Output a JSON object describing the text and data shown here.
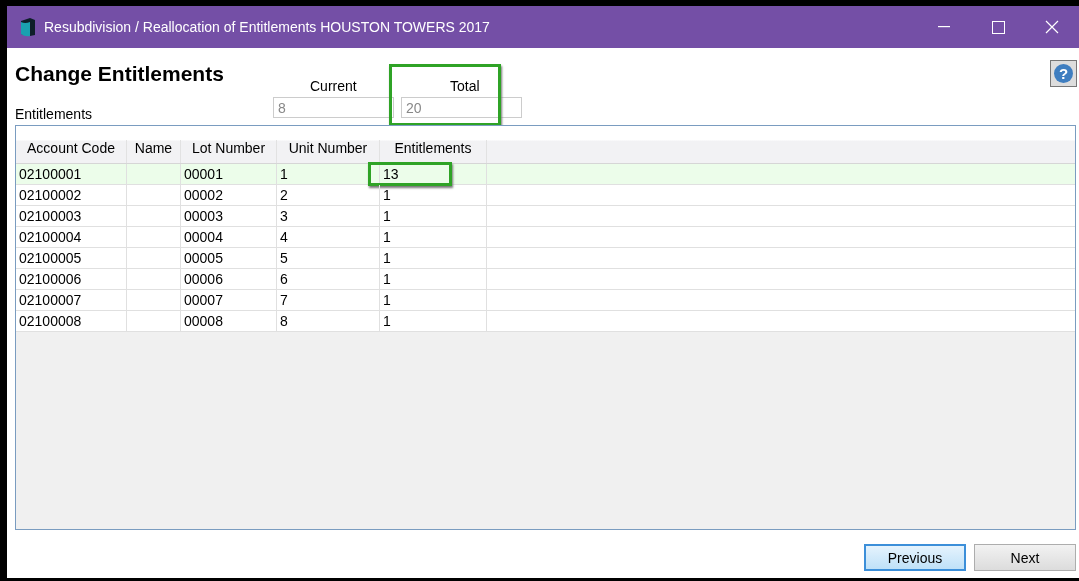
{
  "window": {
    "title": "Resubdivision / Reallocation of Entitlements HOUSTON TOWERS 2017"
  },
  "heading": "Change Entitlements",
  "help_button": "?",
  "summary": {
    "row_label": "Entitlements",
    "current": {
      "label": "Current",
      "value": "8"
    },
    "total": {
      "label": "Total",
      "value": "20",
      "highlighted": true
    }
  },
  "table": {
    "columns": [
      "Account Code",
      "Name",
      "Lot Number",
      "Unit Number",
      "Entitlements"
    ],
    "rows": [
      {
        "cells": [
          "02100001",
          "",
          "00001",
          "1",
          "13"
        ],
        "selected": true,
        "highlighted": true
      },
      {
        "cells": [
          "02100002",
          "",
          "00002",
          "2",
          "1"
        ],
        "selected": false,
        "highlighted": false
      },
      {
        "cells": [
          "02100003",
          "",
          "00003",
          "3",
          "1"
        ],
        "selected": false,
        "highlighted": false
      },
      {
        "cells": [
          "02100004",
          "",
          "00004",
          "4",
          "1"
        ],
        "selected": false,
        "highlighted": false
      },
      {
        "cells": [
          "02100005",
          "",
          "00005",
          "5",
          "1"
        ],
        "selected": false,
        "highlighted": false
      },
      {
        "cells": [
          "02100006",
          "",
          "00006",
          "6",
          "1"
        ],
        "selected": false,
        "highlighted": false
      },
      {
        "cells": [
          "02100007",
          "",
          "00007",
          "7",
          "1"
        ],
        "selected": false,
        "highlighted": false
      },
      {
        "cells": [
          "02100008",
          "",
          "00008",
          "8",
          "1"
        ],
        "selected": false,
        "highlighted": false
      }
    ]
  },
  "buttons": [
    {
      "label": "Previous",
      "default": true
    },
    {
      "label": "Next",
      "default": false
    }
  ]
}
